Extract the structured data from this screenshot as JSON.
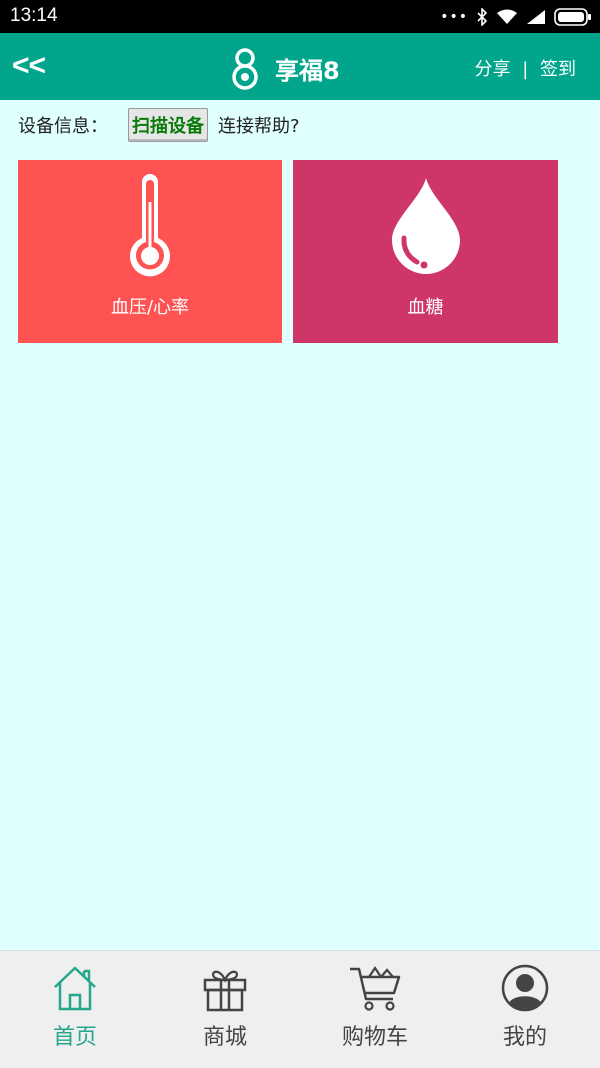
{
  "status_bar": {
    "time": "13:14",
    "icons": [
      "dots-icon",
      "bluetooth-icon",
      "wifi-icon",
      "signal-icon",
      "battery-icon"
    ]
  },
  "header": {
    "back_label": "<<",
    "title": "享福8",
    "share_label": "分享",
    "separator": "|",
    "checkin_label": "签到"
  },
  "info_bar": {
    "device_label": "设备信息：",
    "scan_button": "扫描设备",
    "help_link": "连接帮助?"
  },
  "tiles": [
    {
      "label": "血压/心率",
      "icon": "thermometer-icon",
      "color": "#ff5252"
    },
    {
      "label": "血糖",
      "icon": "blood-drop-icon",
      "color": "#cf3668"
    }
  ],
  "tabs": [
    {
      "label": "首页",
      "icon": "home-icon",
      "active": true
    },
    {
      "label": "商城",
      "icon": "gift-icon",
      "active": false
    },
    {
      "label": "购物车",
      "icon": "cart-icon",
      "active": false
    },
    {
      "label": "我的",
      "icon": "user-icon",
      "active": false
    }
  ],
  "colors": {
    "header": "#00a58b",
    "background": "#e0ffff",
    "active_tab": "#26a68c"
  }
}
